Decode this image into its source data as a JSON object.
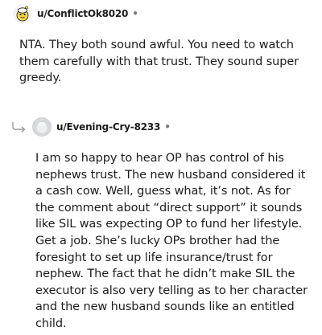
{
  "comments": [
    {
      "username": "u/ConflictOk8020",
      "separator": "•",
      "avatar_icon": "snoo-avatar-yellow",
      "body": "NTA. They both sound awful. You need to watch them carefully with that trust. They sound super greedy."
    },
    {
      "username": "u/Evening-Cry-8233",
      "separator": "•",
      "avatar_icon": "default-avatar-grey",
      "reply_icon": "reply-arrow-icon",
      "body": "I am so happy to hear OP has control of his nephews trust. The new husband considered it a cash cow. Well, guess what, it’s not. As for the comment about “direct support” it sounds like SIL was expecting OP to fund her lifestyle. Get a job. She’s lucky OPs brother had the foresight to set up life insurance/trust for nephew. The fact that he didn’t make SIL the executor is also very telling as to her character and the new husband sounds like an entitled child."
    }
  ],
  "colors": {
    "text": "#1c1c1c",
    "meta": "#7c7c7c",
    "avatar_yellow": "#f5d547",
    "avatar_grey": "#d7dadc"
  }
}
